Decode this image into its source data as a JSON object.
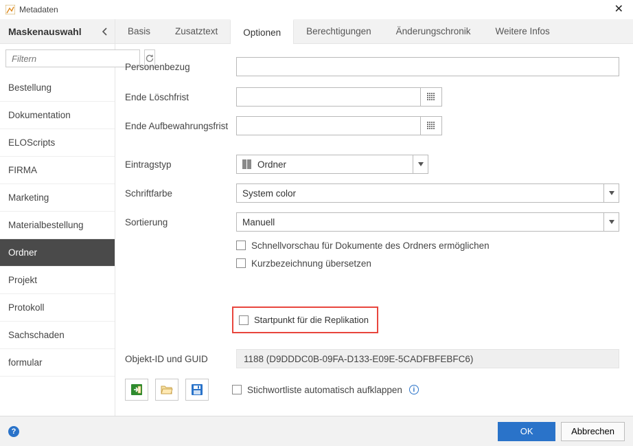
{
  "window": {
    "title": "Metadaten"
  },
  "sidebar": {
    "title": "Maskenauswahl",
    "filter_placeholder": "Filtern",
    "items": [
      {
        "label": "Bestellung"
      },
      {
        "label": "Dokumentation"
      },
      {
        "label": "ELOScripts"
      },
      {
        "label": "FIRMA"
      },
      {
        "label": "Marketing"
      },
      {
        "label": "Materialbestellung"
      },
      {
        "label": "Ordner"
      },
      {
        "label": "Projekt"
      },
      {
        "label": "Protokoll"
      },
      {
        "label": "Sachschaden"
      },
      {
        "label": "formular"
      }
    ],
    "selected_index": 6
  },
  "tabs": {
    "items": [
      {
        "label": "Basis"
      },
      {
        "label": "Zusatztext"
      },
      {
        "label": "Optionen"
      },
      {
        "label": "Berechtigungen"
      },
      {
        "label": "Änderungschronik"
      },
      {
        "label": "Weitere Infos"
      }
    ],
    "active_index": 2
  },
  "form": {
    "personenbezug_label": "Personenbezug",
    "personenbezug_value": "",
    "ende_loeschfrist_label": "Ende Löschfrist",
    "ende_loeschfrist_value": "",
    "ende_aufbewahrung_label": "Ende Aufbewahrungsfrist",
    "ende_aufbewahrung_value": "",
    "eintragstyp_label": "Eintragstyp",
    "eintragstyp_value": "Ordner",
    "schriftfarbe_label": "Schriftfarbe",
    "schriftfarbe_value": "System color",
    "sortierung_label": "Sortierung",
    "sortierung_value": "Manuell",
    "chk_schnellvorschau": "Schnellvorschau für Dokumente des Ordners ermöglichen",
    "chk_kurzbez": "Kurzbezeichnung übersetzen",
    "chk_replikation": "Startpunkt für die Replikation",
    "guid_label": "Objekt-ID und GUID",
    "guid_value": "1188 (D9DDDC0B-09FA-D133-E09E-5CADFBFEBFC6)",
    "chk_stichwort": "Stichwortliste automatisch aufklappen"
  },
  "footer": {
    "ok": "OK",
    "cancel": "Abbrechen"
  }
}
